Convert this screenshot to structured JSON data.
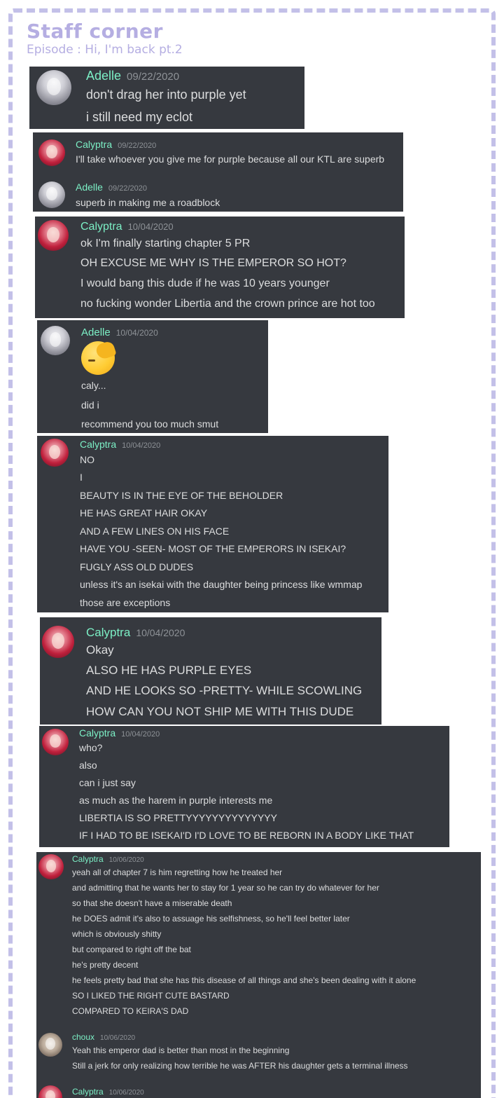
{
  "page": {
    "title": "Staff corner",
    "subtitle": "Episode : Hi, I'm back pt.2"
  },
  "panels": [
    {
      "messages": [
        {
          "user": "Adelle",
          "time": "09/22/2020",
          "avatar": "adelle-avatar",
          "lines": [
            "don't drag her into purple yet",
            "i still need my eclot"
          ]
        }
      ]
    },
    {
      "messages": [
        {
          "user": "Calyptra",
          "time": "09/22/2020",
          "avatar": "calyptra-avatar",
          "lines": [
            "I'll take whoever you give me for purple because all our KTL are superb"
          ]
        },
        {
          "user": "Adelle",
          "time": "09/22/2020",
          "avatar": "adelle-avatar",
          "lines": [
            "superb in making me a roadblock"
          ]
        }
      ]
    },
    {
      "messages": [
        {
          "user": "Calyptra",
          "time": "10/04/2020",
          "avatar": "calyptra-avatar",
          "lines": [
            "ok I'm finally starting chapter 5 PR",
            "OH EXCUSE ME WHY IS THE EMPEROR SO HOT?",
            "I would bang this dude if he was 10 years younger",
            "no fucking wonder Libertia and the crown prince are hot too"
          ]
        }
      ]
    },
    {
      "messages": [
        {
          "user": "Adelle",
          "time": "10/04/2020",
          "avatar": "adelle-avatar",
          "emoji": "facepalm-emoji",
          "lines": [
            "caly...",
            "did i",
            "recommend you too much smut"
          ]
        }
      ]
    },
    {
      "messages": [
        {
          "user": "Calyptra",
          "time": "10/04/2020",
          "avatar": "calyptra-avatar",
          "lines": [
            "NO",
            "I",
            "BEAUTY IS IN THE EYE OF THE BEHOLDER",
            "HE HAS GREAT HAIR OKAY",
            "AND A FEW LINES ON HIS FACE",
            "HAVE YOU -SEEN- MOST OF THE EMPERORS IN ISEKAI?",
            "FUGLY ASS OLD DUDES",
            "unless it's an isekai with the daughter being princess like wmmap",
            "those are exceptions"
          ]
        }
      ]
    },
    {
      "messages": [
        {
          "user": "Calyptra",
          "time": "10/04/2020",
          "avatar": "calyptra-avatar",
          "lines": [
            "Okay",
            "ALSO HE HAS PURPLE EYES",
            "AND HE LOOKS SO -PRETTY- WHILE SCOWLING",
            "HOW CAN YOU NOT SHIP ME WITH THIS DUDE"
          ]
        }
      ]
    },
    {
      "messages": [
        {
          "user": "Calyptra",
          "time": "10/04/2020",
          "avatar": "calyptra-avatar",
          "lines": [
            "who?",
            "also",
            "can i just say",
            "as much as the harem in purple interests me",
            "LIBERTIA IS SO PRETTYYYYYYYYYYYYYY",
            "IF I HAD TO BE ISEKAI'D I'D LOVE TO BE REBORN IN A BODY LIKE THAT"
          ]
        }
      ]
    },
    {
      "messages": [
        {
          "user": "Calyptra",
          "time": "10/06/2020",
          "avatar": "calyptra-avatar",
          "lines": [
            "yeah all of chapter 7 is him regretting how he treated her",
            "and admitting that he wants her to stay for 1 year so he can try do whatever for her",
            "so that she doesn't have a miserable death",
            "he DOES admit it's also to assuage his selfishness, so he'll feel better later",
            "which is obviously shitty",
            "but compared to right off the bat",
            "he's pretty decent",
            "he feels pretty bad that she has this disease of all things and she's been dealing with it alone",
            "SO I LIKED THE RIGHT CUTE BASTARD",
            "COMPARED TO KEIRA'S DAD"
          ]
        },
        {
          "user": "choux",
          "time": "10/06/2020",
          "avatar": "choux-avatar",
          "lines": [
            "Yeah this emperor dad is better than most in the beginning",
            "Still a jerk for only realizing how terrible he was AFTER his daughter gets a terminal illness"
          ]
        },
        {
          "user": "Calyptra",
          "time": "10/06/2020",
          "avatar": "calyptra-avatar",
          "lines": []
        }
      ]
    }
  ]
}
